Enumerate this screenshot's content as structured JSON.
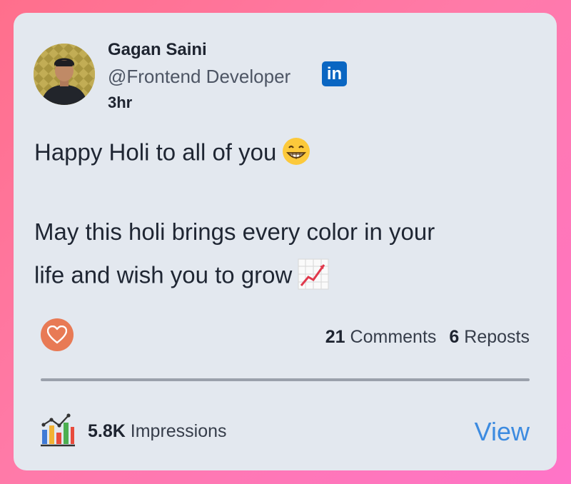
{
  "post": {
    "author_name": "Gagan Saini",
    "author_handle": "@Frontend Developer",
    "time": "3hr",
    "platform_badge": "in",
    "line1": "Happy Holi to all of you",
    "line2": "May this holi brings every color in your",
    "line3": "life and wish you to grow",
    "emoji1": "grinning-face-icon",
    "emoji2": "chart-increasing-icon"
  },
  "engagement": {
    "comments_count": "21",
    "comments_label": "Comments",
    "reposts_count": "6",
    "reposts_label": "Reposts"
  },
  "footer": {
    "impressions_count": "5.8K",
    "impressions_label": "Impressions",
    "view_label": "View"
  },
  "colors": {
    "background_gradient_start": "#ff6f8c",
    "background_gradient_end": "#ff74c8",
    "card": "#e3e8ef",
    "linkedin": "#0a66c2",
    "like_button": "#e87a55",
    "view_link": "#3d8be0"
  }
}
